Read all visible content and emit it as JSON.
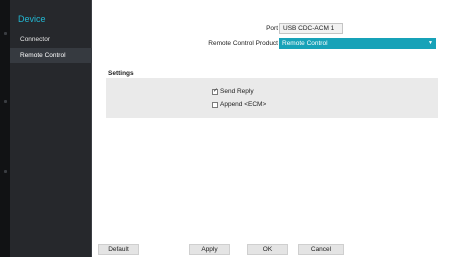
{
  "sidebar": {
    "title": "Device",
    "items": [
      {
        "label": "Connector"
      },
      {
        "label": "Remote Control"
      }
    ]
  },
  "form": {
    "port_label": "Port",
    "port_value": "USB CDC-ACM 1",
    "product_label": "Remote Control Product",
    "product_value": "Remote Control"
  },
  "settings": {
    "title": "Settings",
    "send_reply": {
      "label": "Send Reply",
      "checked": true
    },
    "append_ecm": {
      "label": "Append <ECM>",
      "checked": false
    }
  },
  "buttons": {
    "default_label": "Default",
    "apply_label": "Apply",
    "ok_label": "OK",
    "cancel_label": "Cancel"
  },
  "colors": {
    "accent": "#17a2b8",
    "sidebar_bg": "#26282c",
    "sidebar_title": "#22b7d2"
  },
  "icons": {
    "dropdown": "chevron-down-icon",
    "checkbox": "checkbox-icon"
  }
}
